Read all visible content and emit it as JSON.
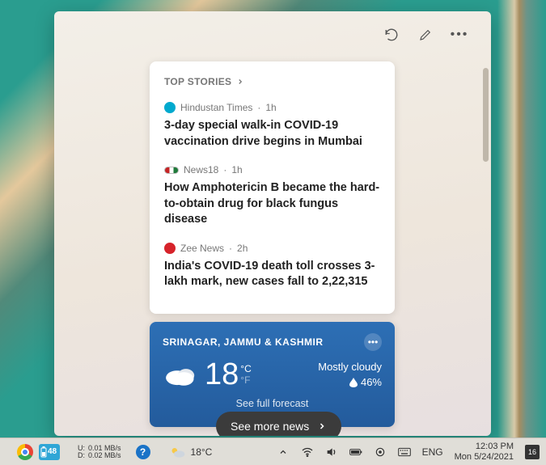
{
  "news": {
    "header": "TOP STORIES",
    "stories": [
      {
        "source": "Hindustan Times",
        "age": "1h",
        "title": "3-day special walk-in COVID-19 vaccination drive begins in Mumbai"
      },
      {
        "source": "News18",
        "age": "1h",
        "title": "How Amphotericin B became the hard-to-obtain drug for black fungus disease"
      },
      {
        "source": "Zee News",
        "age": "2h",
        "title": "India's COVID-19 death toll crosses 3-lakh mark, new cases fall to 2,22,315"
      }
    ]
  },
  "weather": {
    "location": "SRINAGAR, JAMMU & KASHMIR",
    "temp": "18",
    "unit_c": "°C",
    "unit_f": "°F",
    "condition": "Mostly cloudy",
    "humidity": "46%",
    "forecast_label": "See full forecast"
  },
  "see_more": "See more news",
  "taskbar": {
    "battery": "48",
    "net": {
      "up_label": "U:",
      "down_label": "D:",
      "up": "0.01 MB/s",
      "down": "0.02 MB/s"
    },
    "weather_temp": "18°C",
    "lang": "ENG",
    "time": "12:03 PM",
    "date": "Mon 5/24/2021",
    "notif_count": "16"
  }
}
